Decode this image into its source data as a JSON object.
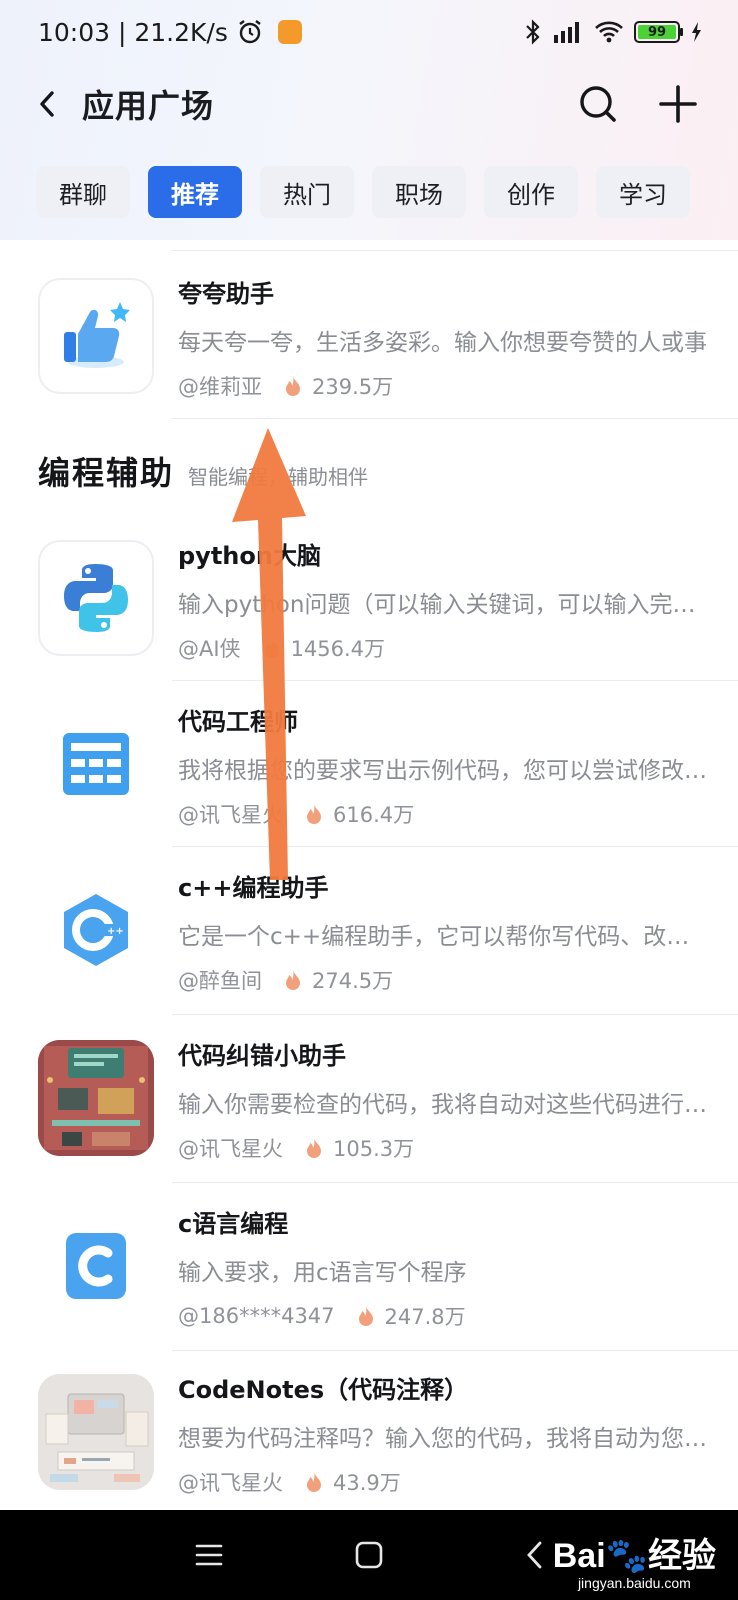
{
  "status_bar": {
    "time_speed": "10:03 | 21.2K/s",
    "battery": "99"
  },
  "header": {
    "title": "应用广场"
  },
  "tabs": [
    {
      "label": "群聊",
      "active": false
    },
    {
      "label": "推荐",
      "active": true
    },
    {
      "label": "热门",
      "active": false
    },
    {
      "label": "职场",
      "active": false
    },
    {
      "label": "创作",
      "active": false
    },
    {
      "label": "学习",
      "active": false
    }
  ],
  "featured": {
    "title": "夸夸助手",
    "desc": "每天夸一夸，生活多姿彩。输入你想要夸赞的人或事",
    "author": "@维莉亚",
    "heat": "239.5万"
  },
  "section": {
    "title": "编程辅助",
    "subtitle": "智能编程，辅助相伴"
  },
  "apps": [
    {
      "title": "python大脑",
      "desc": "输入python问题（可以输入关键词，可以输入完整问题）",
      "author": "@AI侠",
      "heat": "1456.4万"
    },
    {
      "title": "代码工程师",
      "desc": "我将根据您的要求写出示例代码，您可以尝试修改完善",
      "author": "@讯飞星火",
      "heat": "616.4万"
    },
    {
      "title": "c++编程助手",
      "desc": "它是一个c++编程助手，它可以帮你写代码、改代码",
      "author": "@醉鱼间",
      "heat": "274.5万"
    },
    {
      "title": "代码纠错小助手",
      "desc": "输入你需要检查的代码，我将自动对这些代码进行纠错",
      "author": "@讯飞星火",
      "heat": "105.3万"
    },
    {
      "title": "c语言编程",
      "desc": "输入要求，用c语言写个程序",
      "author": "@186****4347",
      "heat": "247.8万"
    },
    {
      "title": "CodeNotes（代码注释）",
      "desc": "想要为代码注释吗？输入您的代码，我将自动为您添加注释",
      "author": "@讯飞星火",
      "heat": "43.9万"
    }
  ],
  "watermark": {
    "logo": "Bai",
    "logo_suffix": "经验",
    "url": "jingyan.baidu.com"
  },
  "colors": {
    "accent": "#2b6de8",
    "arrow": "#f07a3e",
    "fire": "#f2a07b"
  }
}
